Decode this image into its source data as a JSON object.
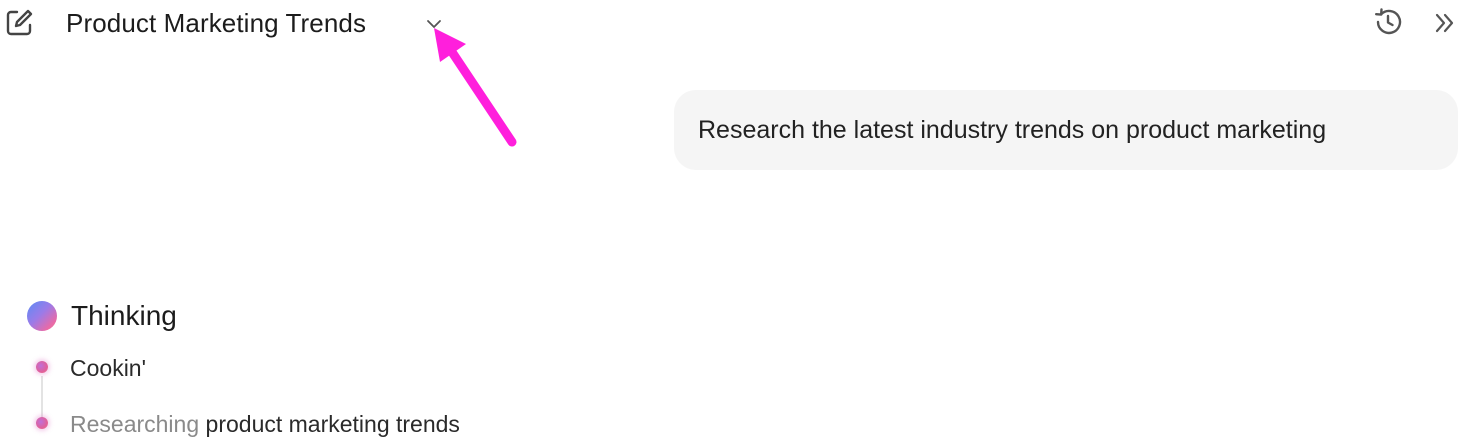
{
  "header": {
    "title": "Product Marketing Trends",
    "icons": {
      "edit": "edit-icon",
      "dropdown": "chevron-down-icon",
      "history": "history-icon",
      "collapse": "double-chevron-right-icon"
    }
  },
  "conversation": {
    "user_message": "Research the latest industry trends on product marketing"
  },
  "thinking": {
    "label": "Thinking",
    "steps": [
      {
        "text": "Cookin'"
      },
      {
        "text_dim": "Researching",
        "text_rest": " product marketing trends"
      }
    ]
  },
  "annotation": {
    "color": "#ff1fdc"
  },
  "colors": {
    "bubble_bg": "#f5f5f5",
    "orb_start": "#5b8cf5",
    "orb_end": "#f0808e"
  }
}
